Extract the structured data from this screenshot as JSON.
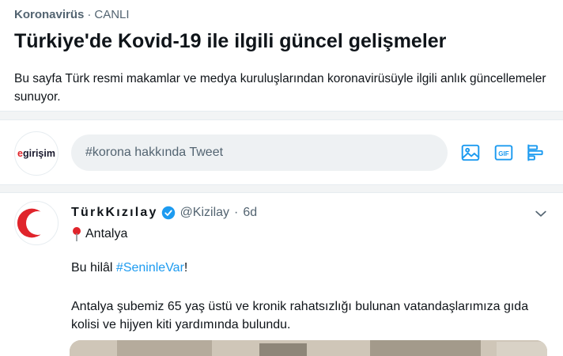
{
  "header": {
    "topic": "Koronavirüs",
    "separator": "·",
    "status": "CANLI",
    "title": "Türkiye'de Kovid-19 ile ilgili güncel gelişmeler",
    "description": "Bu sayfa Türk resmi makamlar ve medya kuruluşlarından koronavirüsüyle ilgili anlık güncellemeler sunuyor."
  },
  "compose": {
    "avatar_prefix": "e",
    "avatar_rest": "girişim",
    "placeholder": "#korona hakkında Tweet",
    "tools": [
      "image-icon",
      "gif-icon",
      "poll-icon"
    ]
  },
  "tweet": {
    "name": "TürkKızılay",
    "handle": "@Kizilay",
    "separator": "·",
    "age": "6d",
    "location": "Antalya",
    "line1_prefix": "Bu hilâl ",
    "hashtag": "#SeninleVar",
    "line1_suffix": "!",
    "body": "Antalya şubemiz 65 yaş üstü ve kronik rahatsızlığı bulunan vatandaşlarımıza gıda kolisi ve hijyen kiti yardımında bulundu."
  },
  "colors": {
    "accent": "#1d9bf0",
    "brand_red": "#e0242b",
    "muted": "#536471"
  }
}
